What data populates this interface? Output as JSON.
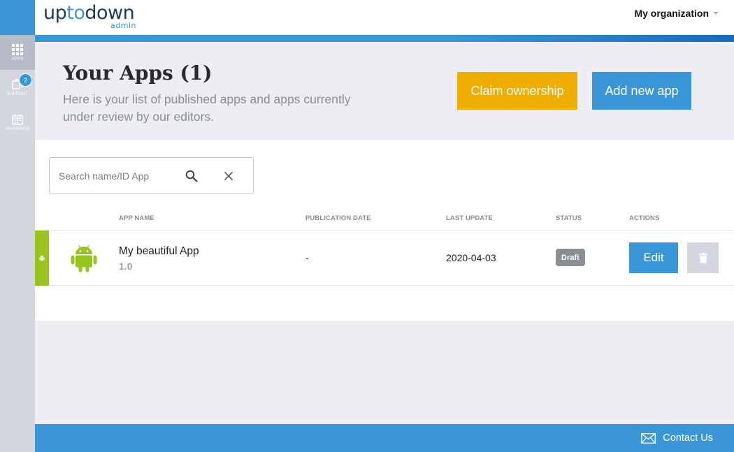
{
  "colors": {
    "brand_blue": "#3b96d8",
    "claim_yellow": "#f0ae00",
    "android_green": "#97c41e",
    "draft_gray": "#8a8d94"
  },
  "sidebar": {
    "items": [
      {
        "label": "APPS",
        "icon": "grid-icon",
        "active": true
      },
      {
        "label": "SUPPORT",
        "icon": "support-icon",
        "badge": "2"
      },
      {
        "label": "WARNINGS",
        "icon": "calendar-icon"
      }
    ]
  },
  "header": {
    "logo_main_a": "up",
    "logo_main_b": "to",
    "logo_main_c": "down",
    "logo_sub": "admin",
    "organization": "My organization"
  },
  "hero": {
    "title": "Your Apps (1)",
    "subtitle": "Here is your list of published apps and apps currently under review by our editors.",
    "claim_label": "Claim ownership",
    "add_label": "Add new app"
  },
  "search": {
    "placeholder": "Search name/ID App",
    "value": ""
  },
  "table": {
    "columns": [
      "APP NAME",
      "PUBLICATION DATE",
      "LAST UPDATE",
      "STATUS",
      "ACTIONS"
    ],
    "rows": [
      {
        "platform": "android",
        "name": "My beautiful App",
        "version": "1.0",
        "publication_date": "-",
        "last_update": "2020-04-03",
        "status": "Draft",
        "edit_label": "Edit"
      }
    ]
  },
  "footer": {
    "contact_label": "Contact Us"
  }
}
